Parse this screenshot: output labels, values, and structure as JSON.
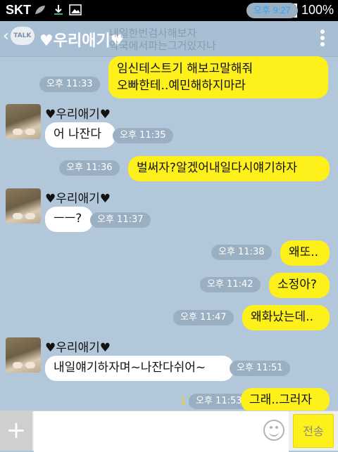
{
  "status_bar": {
    "carrier": "SKT",
    "battery": "100%",
    "time": "오후 9:27",
    "icons": [
      "leaf-icon",
      "download-icon",
      "image-icon",
      "wifi-icon",
      "signal-icon",
      "battery-icon"
    ]
  },
  "header": {
    "back_label": "TALK",
    "title": "♥우리애기♥"
  },
  "notice": {
    "line1": "내일한번검사해보자",
    "line2": "약국에서파는그거있자나"
  },
  "messages": [
    {
      "sender": "me",
      "text_line1": "임신테스트기 해보고말해줘",
      "text_line2": "오빠한테..예민해하지마라",
      "time": "오후 11:33"
    },
    {
      "sender": "other",
      "name": "♥우리애기♥",
      "text": "어 나잔다",
      "time": "오후 11:35"
    },
    {
      "sender": "me",
      "text": "벌써자?알겠어내일다시얘기하자",
      "time": "오후 11:36"
    },
    {
      "sender": "other",
      "name": "♥우리애기♥",
      "text": "ㅡㅡ?",
      "time": "오후 11:37"
    },
    {
      "sender": "me",
      "text": "왜또..",
      "time": "오후 11:38"
    },
    {
      "sender": "me",
      "text": "소정아?",
      "time": "오후 11:42"
    },
    {
      "sender": "me",
      "text": "왜화났는데..",
      "time": "오후 11:47"
    },
    {
      "sender": "other",
      "name": "♥우리애기♥",
      "text": "내일얘기하자며~나잔다쉬어~",
      "time": "오후 11:51"
    },
    {
      "sender": "me",
      "text": "그래..그러자",
      "time": "오후 11:53",
      "unread": "1"
    }
  ],
  "input_bar": {
    "placeholder": "",
    "send_label": "전송"
  },
  "colors": {
    "chat_background": "#b2c7d9",
    "my_bubble": "#fef01b",
    "other_bubble": "#ffffff",
    "timestamp_pill": "#9bafc2"
  }
}
